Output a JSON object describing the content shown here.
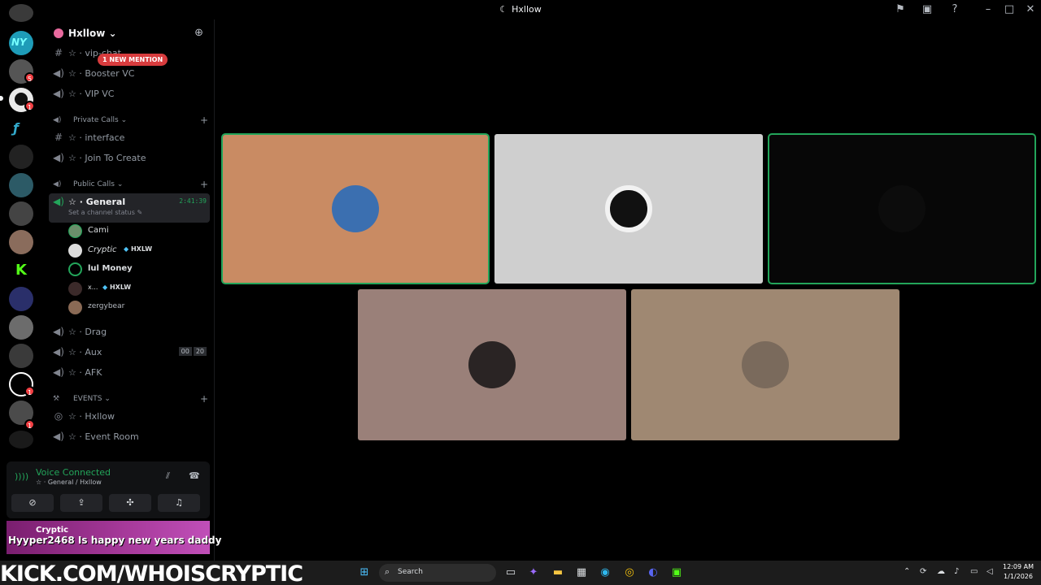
{
  "window": {
    "title": "Hxllow"
  },
  "server_rail": {
    "badges": [
      "5",
      "1",
      "1",
      "1"
    ]
  },
  "guild": {
    "name": "Hxllow",
    "mention_badge": "1 NEW MENTION"
  },
  "channels": {
    "vip_chat": "vip-chat",
    "booster_vc": "Booster VC",
    "vip_vc": "VIP VC",
    "private_calls_category": "Private Calls",
    "interface": "interface",
    "join_to_create": "Join To Create",
    "public_calls_category": "Public Calls",
    "general": "General",
    "general_status": "Set a channel status",
    "general_timer": "2:41:39",
    "drag": "Drag",
    "aux": "Aux",
    "aux_count_a": "00",
    "aux_count_b": "20",
    "afk": "AFK",
    "events_category": "EVENTS",
    "hxllow_stage": "Hxllow",
    "event_room": "Event Room"
  },
  "voice_users": [
    {
      "name": "Cami",
      "tag": ""
    },
    {
      "name": "Cryptic",
      "tag": "HXLW"
    },
    {
      "name": "lul Money",
      "tag": ""
    },
    {
      "name": "x...",
      "tag": "HXLW"
    },
    {
      "name": "zergybear",
      "tag": ""
    }
  ],
  "voice_panel": {
    "status": "Voice Connected",
    "location": "General / Hxllow"
  },
  "overlay": {
    "top_name": "Cryptic",
    "message": "Hyyper2468  Is happy new years daddy"
  },
  "stream_banner": {
    "text": "KICK.COM/WHOISCRYPTIC"
  },
  "taskbar": {
    "search_placeholder": "Search",
    "time": "12:09 AM",
    "date": "1/1/2026"
  },
  "tiles": [
    {
      "background": "#c98b63",
      "speaking": true
    },
    {
      "background": "#cfcfcf",
      "speaking": false
    },
    {
      "background": "#070707",
      "speaking": true
    },
    {
      "background": "#9a8079",
      "speaking": false
    },
    {
      "background": "#9f8872",
      "speaking": false
    }
  ],
  "colors": {
    "accent_green": "#23a55a",
    "mention_red": "#d83c3e",
    "badge_red": "#f23f43"
  }
}
